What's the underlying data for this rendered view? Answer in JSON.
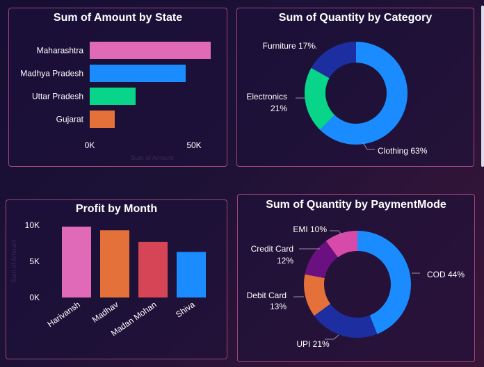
{
  "colors": {
    "pink": "#e06ab8",
    "blue": "#1a8cff",
    "green": "#08d48a",
    "orange": "#e4703a",
    "red": "#d64555",
    "navy": "#1c2ea0",
    "purple": "#6a1080",
    "magenta": "#d84aaa"
  },
  "chart_data": [
    {
      "type": "bar",
      "orientation": "horizontal",
      "title": "Sum of Amount by State",
      "categories": [
        "Maharashtra",
        "Madhya Pradesh",
        "Uttar Pradesh",
        "Gujarat"
      ],
      "values": [
        58000,
        46000,
        22000,
        12000
      ],
      "colors": [
        "#e06ab8",
        "#1a8cff",
        "#08d48a",
        "#e4703a"
      ],
      "xlabel": "Sum of Amount",
      "ticks": [
        "0K",
        "50K"
      ],
      "xlim": [
        0,
        60000
      ]
    },
    {
      "type": "pie",
      "variant": "donut",
      "title": "Sum of Quantity by Category",
      "slices": [
        {
          "label": "Clothing 63%",
          "value": 63,
          "color": "#1a8cff"
        },
        {
          "label": "Electronics",
          "pct_label": "21%",
          "value": 21,
          "color": "#08d48a"
        },
        {
          "label": "Furniture 17%",
          "value": 17,
          "color": "#1c2ea0"
        }
      ]
    },
    {
      "type": "bar",
      "title": "Profit by Month",
      "categories": [
        "Harivansh",
        "Madhav",
        "Madan Mohan",
        "Shiva"
      ],
      "values": [
        9800,
        9300,
        7700,
        6300
      ],
      "colors": [
        "#e06ab8",
        "#e4703a",
        "#d64555",
        "#1a8cff"
      ],
      "ylabel": "Sum of Amount",
      "ticks": [
        "10K",
        "5K",
        "0K"
      ],
      "ylim": [
        0,
        10000
      ]
    },
    {
      "type": "pie",
      "variant": "donut",
      "title": "Sum of Quantity by PaymentMode",
      "slices": [
        {
          "label": "COD 44%",
          "value": 44,
          "color": "#1a8cff"
        },
        {
          "label": "UPI 21%",
          "value": 21,
          "color": "#1c2ea0"
        },
        {
          "label": "Debit Card",
          "pct_label": "13%",
          "value": 13,
          "color": "#e4703a"
        },
        {
          "label": "Credit Card",
          "pct_label": "12%",
          "value": 12,
          "color": "#6a1080"
        },
        {
          "label": "EMI 10%",
          "value": 10,
          "color": "#d84aaa"
        }
      ]
    }
  ]
}
